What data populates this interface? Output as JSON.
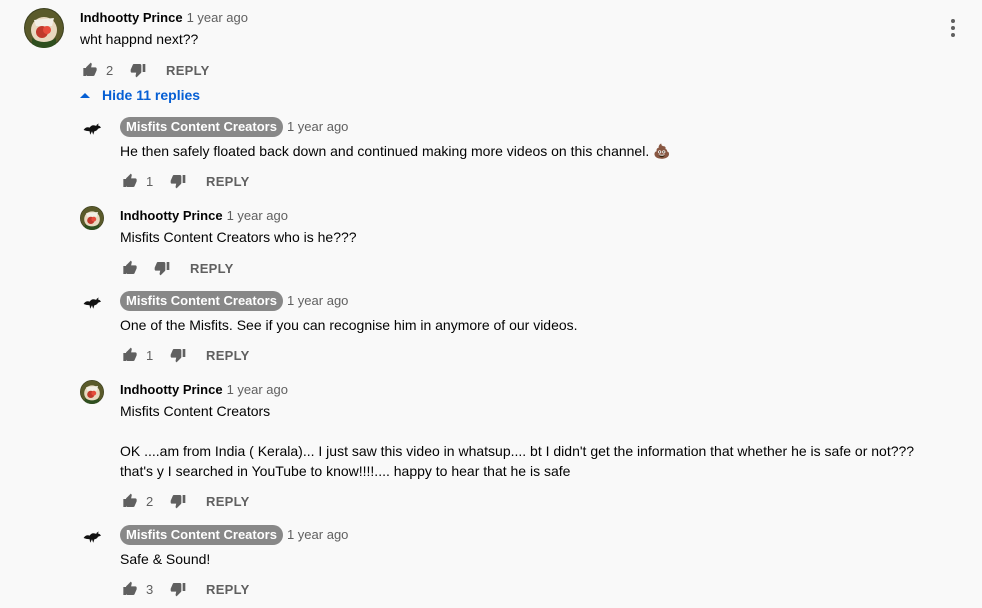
{
  "colors": {
    "accent": "#065fd4",
    "badge": "#888888",
    "muted": "#606060"
  },
  "icons": {
    "like": "thumb-up-icon",
    "dislike": "thumb-down-icon",
    "menu": "three-dot-menu-icon",
    "collapse": "caret-up-icon"
  },
  "top_comment": {
    "author": "Indhootty Prince",
    "time": "1 year ago",
    "text": "wht happnd next??",
    "likes": "2",
    "reply_label": "REPLY"
  },
  "replies_toggle": {
    "label": "Hide 11 replies"
  },
  "replies": [
    {
      "author": "Misfits Content Creators",
      "time": "1 year ago",
      "text": "He then safely floated back down and continued making more videos on this channel.",
      "emoji": "💩",
      "likes": "1",
      "reply_label": "REPLY"
    },
    {
      "author": "Indhootty Prince",
      "time": "1 year ago",
      "text": "Misfits Content Creators who is he???",
      "likes": "",
      "reply_label": "REPLY"
    },
    {
      "author": "Misfits Content Creators",
      "time": "1 year ago",
      "text": "One of the Misfits. See if you can recognise him in anymore of our videos.",
      "likes": "1",
      "reply_label": "REPLY"
    },
    {
      "author": "Indhootty Prince",
      "time": "1 year ago",
      "text": "Misfits Content Creators\n\nOK ....am from India ( Kerala)... I just saw this video in whatsup.... bt I didn't get the information that whether he is safe or not???\nthat's y I searched in YouTube to know!!!!.... happy to hear that he is safe",
      "likes": "2",
      "reply_label": "REPLY"
    },
    {
      "author": "Misfits Content Creators",
      "time": "1 year ago",
      "text": "Safe & Sound!",
      "likes": "3",
      "reply_label": "REPLY"
    }
  ]
}
